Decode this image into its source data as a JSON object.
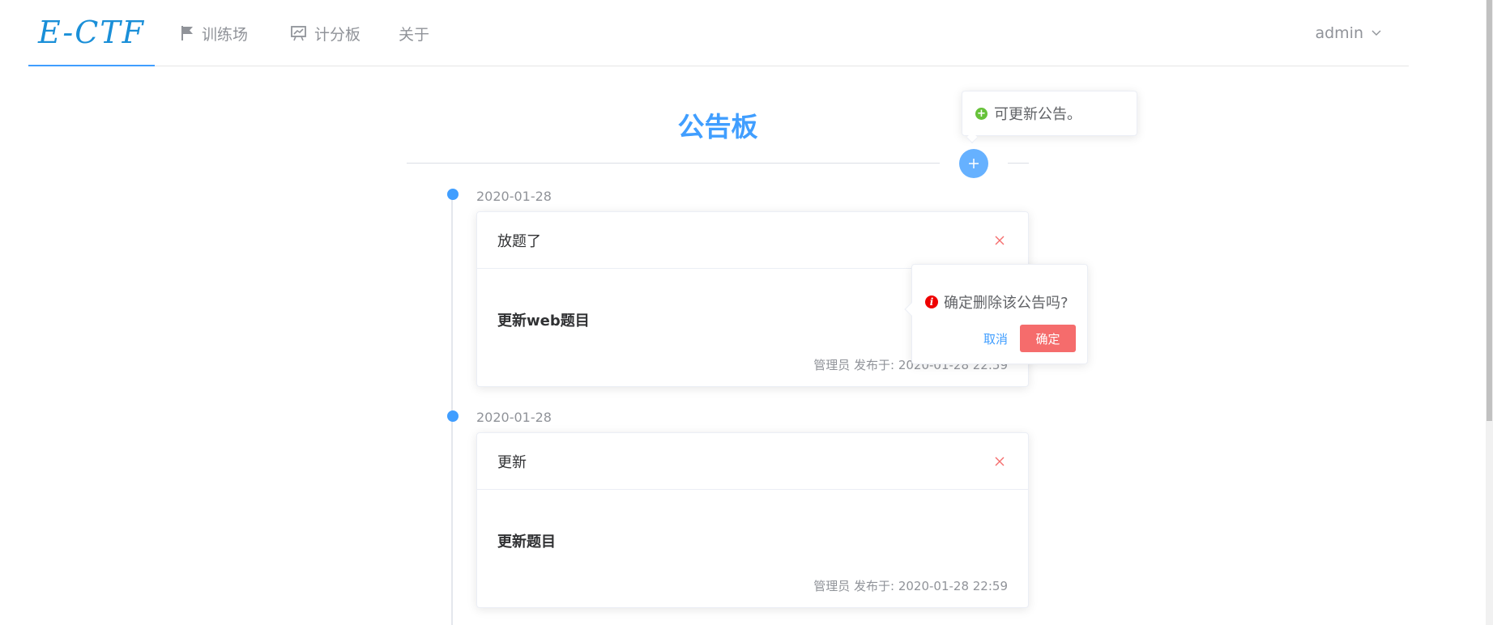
{
  "header": {
    "logo": "E-CTF",
    "nav": [
      {
        "label": "训练场",
        "icon": "flag-icon"
      },
      {
        "label": "计分板",
        "icon": "presentation-chart-icon"
      },
      {
        "label": "关于"
      }
    ],
    "user": "admin"
  },
  "page": {
    "title": "公告板"
  },
  "tooltip": {
    "text": "可更新公告。",
    "icon": "plus-circle-icon",
    "color": "#67c23a"
  },
  "colors": {
    "primary": "#409eff",
    "danger": "#f56c6c"
  },
  "announcements": [
    {
      "date": "2020-01-28",
      "title": "放题了",
      "content": "更新web题目",
      "meta": "管理员 发布于: 2020-01-28 22:59"
    },
    {
      "date": "2020-01-28",
      "title": "更新",
      "content": "更新题目",
      "meta": "管理员 发布于: 2020-01-28 22:59"
    }
  ],
  "popconfirm": {
    "message": "确定删除该公告吗?",
    "cancel": "取消",
    "confirm": "确定"
  }
}
